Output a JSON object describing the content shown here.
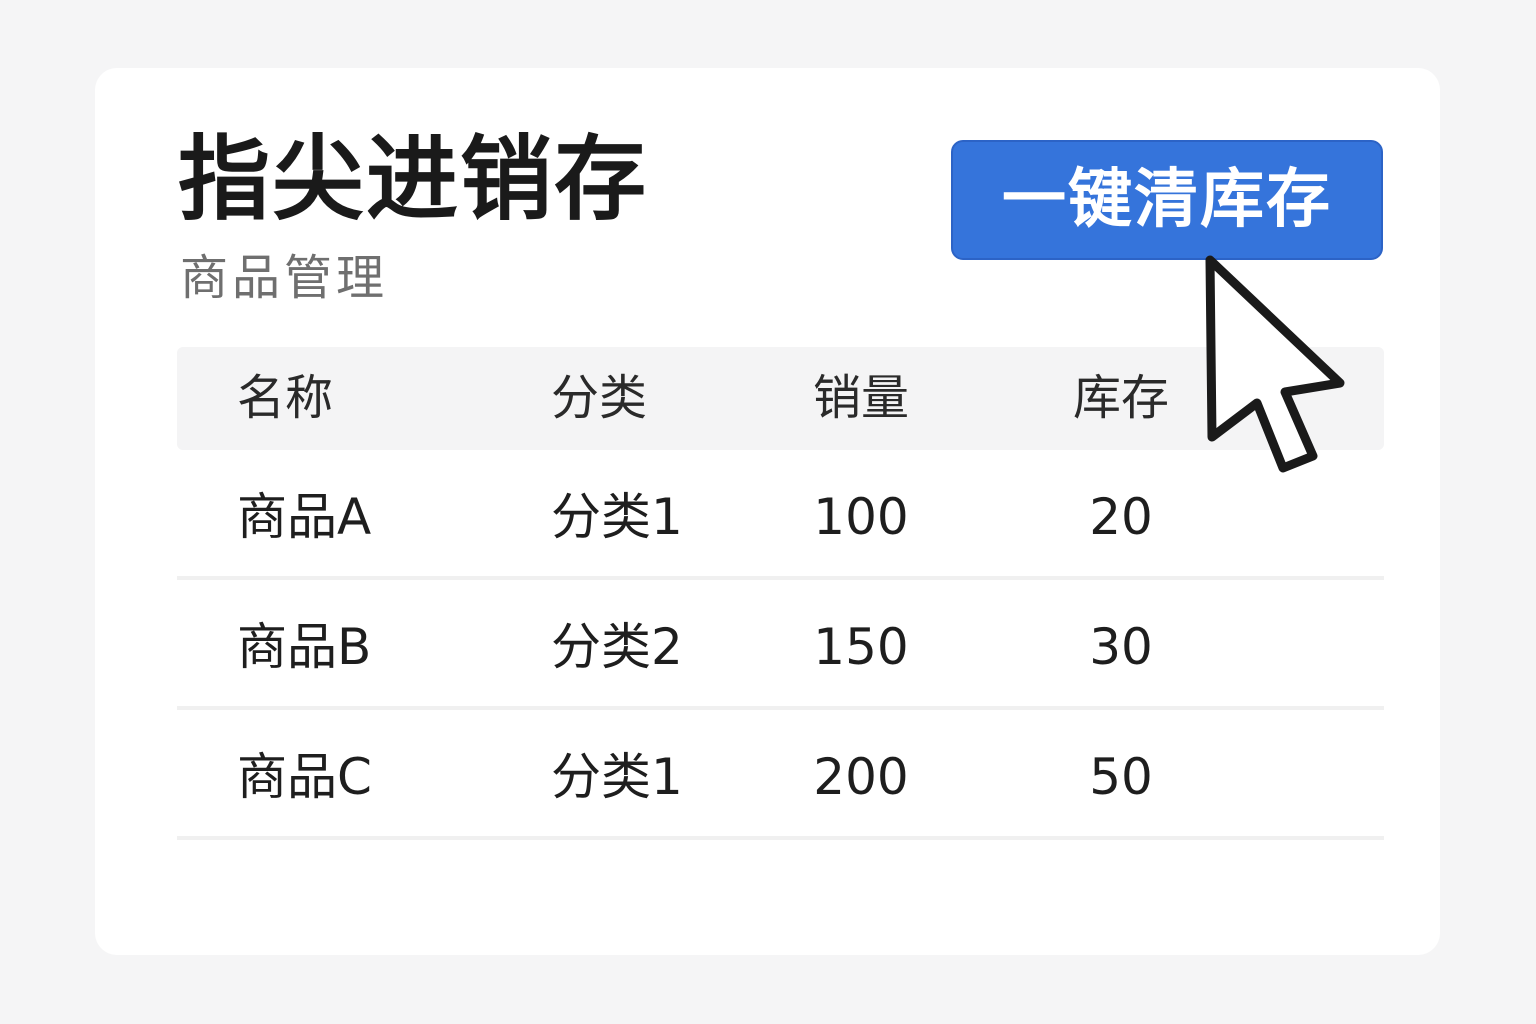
{
  "app": {
    "title": "指尖进销存",
    "subtitle": "商品管理"
  },
  "actions": {
    "clear_stock_label": "一键清库存"
  },
  "table": {
    "headers": {
      "name": "名称",
      "category": "分类",
      "sales": "销量",
      "stock": "库存"
    },
    "rows": [
      {
        "name": "商品A",
        "category": "分类1",
        "sales": "100",
        "stock": "20"
      },
      {
        "name": "商品B",
        "category": "分类2",
        "sales": "150",
        "stock": "30"
      },
      {
        "name": "商品C",
        "category": "分类1",
        "sales": "200",
        "stock": "50"
      }
    ]
  },
  "colors": {
    "accent": "#3574db",
    "background": "#f5f5f6",
    "card": "#ffffff",
    "header_row": "#f4f4f5"
  },
  "icons": {
    "cursor": "mouse-pointer-icon"
  }
}
